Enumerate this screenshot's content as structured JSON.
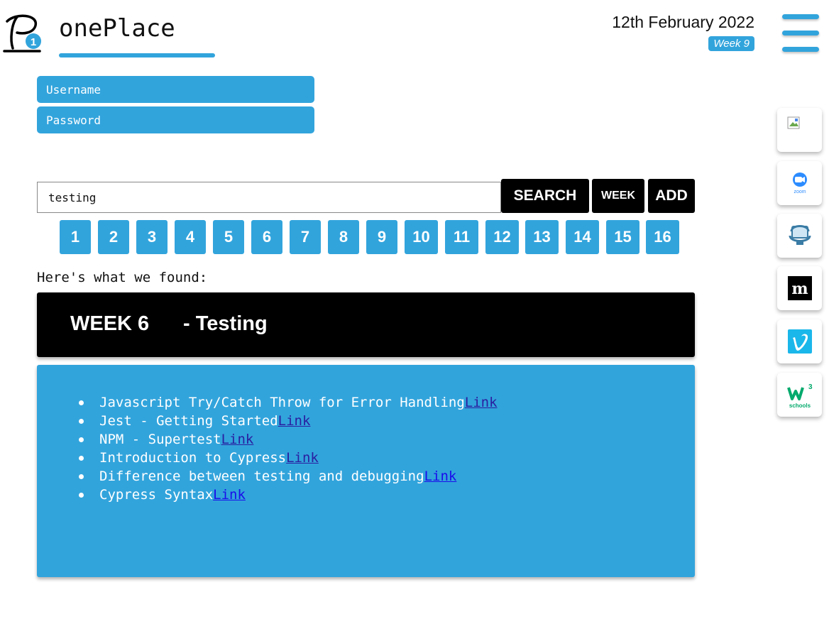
{
  "header": {
    "app_title": "onePlace",
    "date": "12th February 2022",
    "current_week": "Week 9",
    "colors": {
      "accent": "#32a4dc",
      "dark": "#000000"
    }
  },
  "login": {
    "username_placeholder": "Username",
    "password_placeholder": "Password"
  },
  "search": {
    "value": "testing",
    "search_label": "SEARCH",
    "week_label": "WEEK",
    "add_label": "ADD"
  },
  "weeks": [
    "1",
    "2",
    "3",
    "4",
    "5",
    "6",
    "7",
    "8",
    "9",
    "10",
    "11",
    "12",
    "13",
    "14",
    "15",
    "16"
  ],
  "results": {
    "found_text": "Here's what we found:",
    "week_title": "WEEK 6",
    "topic": "- Testing",
    "items": [
      {
        "text": "Javascript Try/Catch Throw for Error Handling",
        "link": "Link"
      },
      {
        "text": "Jest - Getting Started",
        "link": "Link"
      },
      {
        "text": "NPM - Supertest",
        "link": "Link"
      },
      {
        "text": "Introduction to Cypress",
        "link": "Link"
      },
      {
        "text": "Difference between testing and debugging",
        "link": "Link"
      },
      {
        "text": "Cypress Syntax",
        "link": "Link"
      }
    ]
  },
  "sidebar": {
    "apps": [
      "broken-image-icon",
      "zoom-icon",
      "remote-desktop-icon",
      "miro-icon",
      "vimeo-icon",
      "w3schools-icon"
    ],
    "zoom_label": "zoom",
    "w3_label": "schools"
  }
}
